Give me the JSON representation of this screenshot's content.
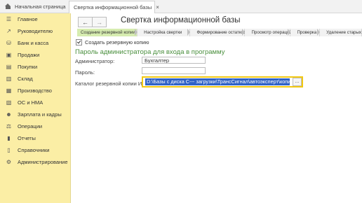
{
  "tabs": {
    "home_label": "Начальная страница",
    "active_label": "Свертка информационной базы",
    "close_symbol": "×"
  },
  "sidebar": {
    "background": "#fbeea5",
    "items": [
      {
        "label": "Главное",
        "icon": "menu-icon"
      },
      {
        "label": "Руководителю",
        "icon": "trend-icon"
      },
      {
        "label": "Банк и касса",
        "icon": "bank-icon"
      },
      {
        "label": "Продажи",
        "icon": "cart-icon"
      },
      {
        "label": "Покупки",
        "icon": "basket-icon"
      },
      {
        "label": "Склад",
        "icon": "warehouse-icon"
      },
      {
        "label": "Производство",
        "icon": "factory-icon"
      },
      {
        "label": "ОС и НМА",
        "icon": "assets-icon"
      },
      {
        "label": "Зарплата и кадры",
        "icon": "people-icon"
      },
      {
        "label": "Операции",
        "icon": "operations-icon"
      },
      {
        "label": "Отчеты",
        "icon": "reports-icon"
      },
      {
        "label": "Справочники",
        "icon": "books-icon"
      },
      {
        "label": "Администрирование",
        "icon": "gear-icon"
      }
    ]
  },
  "main": {
    "title": "Свертка информационной базы",
    "back_symbol": "←",
    "forward_symbol": "→",
    "steps": [
      "Создание резервной копии",
      "Настройка свертки",
      "Формирование остатков",
      "Просмотр операций",
      "Проверка",
      "Удаление старых"
    ],
    "create_backup_label": "Создать резервную копию",
    "section_title": "Пароль администратора для входа в программу",
    "admin_label": "Администратор:",
    "admin_value": "Бухгалтер",
    "password_label": "Пароль:",
    "password_value": "",
    "backup_dir_label": "Каталог резервной копии ИБ:",
    "backup_dir_value": "D:\\Базы с диска С--- загрузки\\ТрансСигнал\\автоэксперт\\копия т",
    "browse_label": "..."
  }
}
